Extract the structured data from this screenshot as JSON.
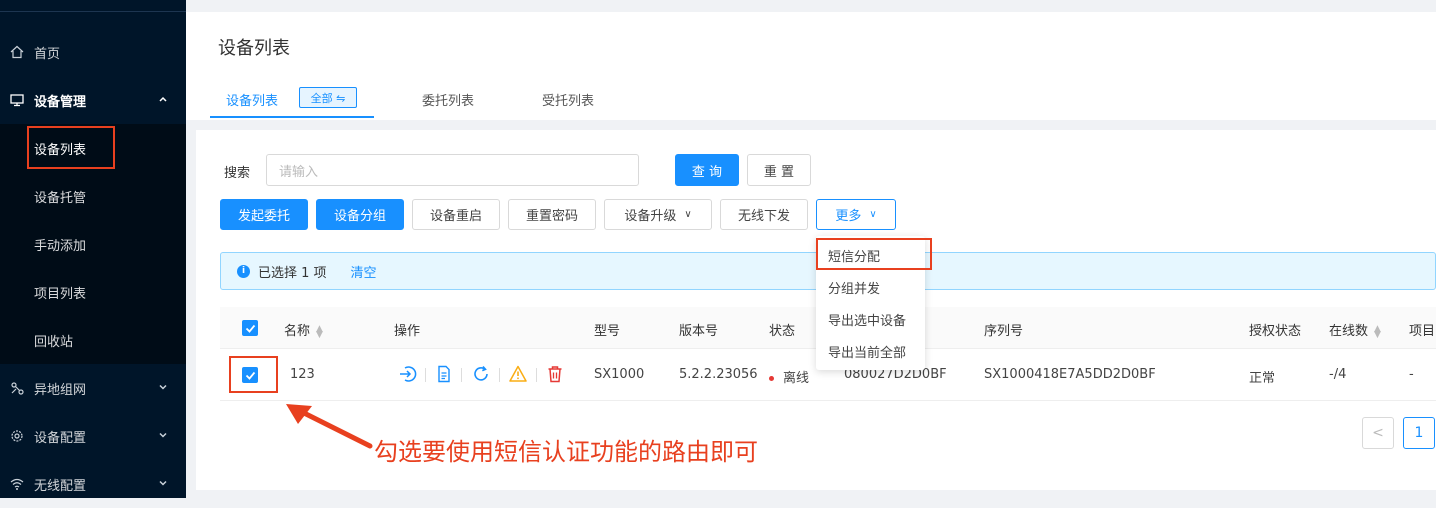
{
  "sidebar": {
    "items": [
      {
        "label": "首页",
        "icon": "home-icon"
      },
      {
        "label": "设备管理",
        "icon": "monitor-icon"
      },
      {
        "label": "异地组网",
        "icon": "network-icon"
      },
      {
        "label": "设备配置",
        "icon": "gear-icon"
      },
      {
        "label": "无线配置",
        "icon": "wifi-icon"
      }
    ],
    "sub_items": [
      {
        "label": "设备列表"
      },
      {
        "label": "设备托管"
      },
      {
        "label": "手动添加"
      },
      {
        "label": "项目列表"
      },
      {
        "label": "回收站"
      }
    ]
  },
  "header": {
    "title": "设备列表",
    "tabs": [
      {
        "label": "设备列表"
      },
      {
        "label": "委托列表"
      },
      {
        "label": "受托列表"
      }
    ],
    "badge": "全部 ⇋"
  },
  "search": {
    "label": "搜索",
    "placeholder": "请输入",
    "query_label": "查 询",
    "reset_label": "重 置"
  },
  "toolbar": {
    "delegate": "发起委托",
    "group": "设备分组",
    "restart": "设备重启",
    "reset_password": "重置密码",
    "upgrade": "设备升级",
    "wireless": "无线下发",
    "more": "更多"
  },
  "dropdown": {
    "items": [
      "短信分配",
      "分组并发",
      "导出选中设备",
      "导出当前全部"
    ]
  },
  "alert": {
    "selected": "已选择 1 项",
    "clear": "清空"
  },
  "table": {
    "headers": {
      "name": "名称",
      "ops": "操作",
      "model": "型号",
      "version": "版本号",
      "status": "状态",
      "serial": "序列号",
      "license": "授权状态",
      "online": "在线数",
      "project": "项目"
    },
    "rows": [
      {
        "name": "123",
        "model": "SX1000",
        "version": "5.2.2.23056",
        "status": "离线",
        "mac": "080027D2D0BF",
        "serial": "SX1000418E7A5DD2D0BF",
        "license": "正常",
        "online": "-/4",
        "project": "-"
      }
    ]
  },
  "pagination": {
    "prev": "<",
    "current": "1"
  },
  "annotation": "勾选要使用短信认证功能的路由即可",
  "colors": {
    "primary": "#1890ff",
    "sidebar_bg": "#001529",
    "annotation_red": "#e8401f",
    "offline_red": "#e53935",
    "warning_orange": "#faad14"
  }
}
